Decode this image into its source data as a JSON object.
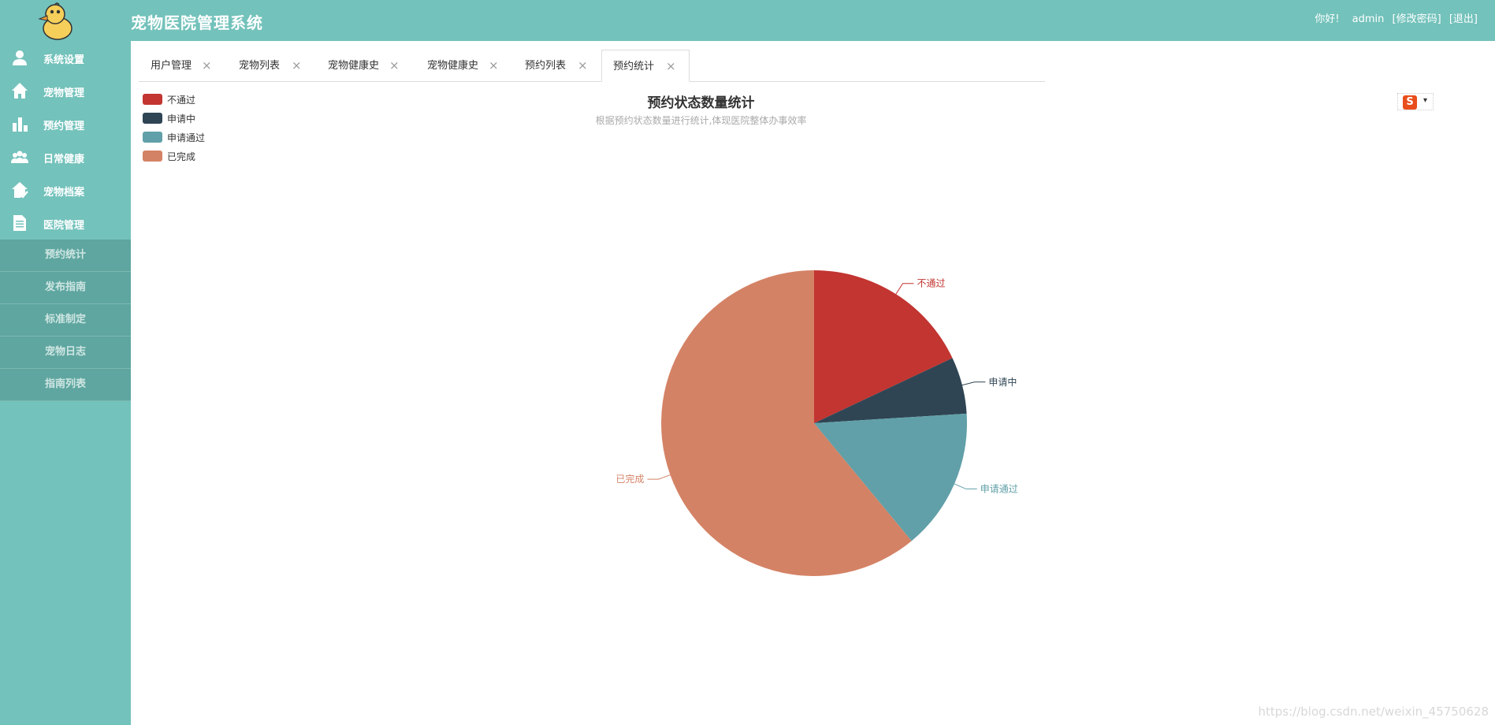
{
  "header": {
    "title": "宠物医院管理系统",
    "greeting": "你好!",
    "username": "admin",
    "change_password": "[修改密码]",
    "logout": "[退出]"
  },
  "sidebar": {
    "items": [
      {
        "label": "系统设置",
        "icon": "user-icon"
      },
      {
        "label": "宠物管理",
        "icon": "home-icon"
      },
      {
        "label": "预约管理",
        "icon": "bar-chart-icon"
      },
      {
        "label": "日常健康",
        "icon": "group-icon"
      },
      {
        "label": "宠物档案",
        "icon": "archive-check-icon"
      },
      {
        "label": "医院管理",
        "icon": "document-icon"
      }
    ],
    "sub_items": [
      {
        "label": "预约统计"
      },
      {
        "label": "发布指南"
      },
      {
        "label": "标准制定"
      },
      {
        "label": "宠物日志"
      },
      {
        "label": "指南列表"
      }
    ]
  },
  "tabs": [
    {
      "label": "用户管理",
      "active": false
    },
    {
      "label": "宠物列表",
      "active": false
    },
    {
      "label": "宠物健康史",
      "active": false
    },
    {
      "label": "宠物健康史",
      "active": false
    },
    {
      "label": "预约列表",
      "active": false
    },
    {
      "label": "预约统计",
      "active": true
    }
  ],
  "tab_close_glyph": "×",
  "toolbox": {
    "icon": "save-image-icon",
    "glyph": "S",
    "caret": "▾"
  },
  "colors": {
    "primary": "#73c2bb",
    "sub_menu": "#5fa6a0"
  },
  "chart_data": {
    "type": "pie",
    "title": "预约状态数量统计",
    "subtitle": "根据预约状态数量进行统计,体现医院整体办事效率",
    "legend_position": "top-left",
    "series": [
      {
        "name": "不通过",
        "value": 18,
        "color": "#c23531"
      },
      {
        "name": "申请中",
        "value": 6,
        "color": "#2f4554"
      },
      {
        "name": "申请通过",
        "value": 15,
        "color": "#61a0a8"
      },
      {
        "name": "已完成",
        "value": 61,
        "color": "#d48265"
      }
    ]
  },
  "watermark": "https://blog.csdn.net/weixin_45750628"
}
